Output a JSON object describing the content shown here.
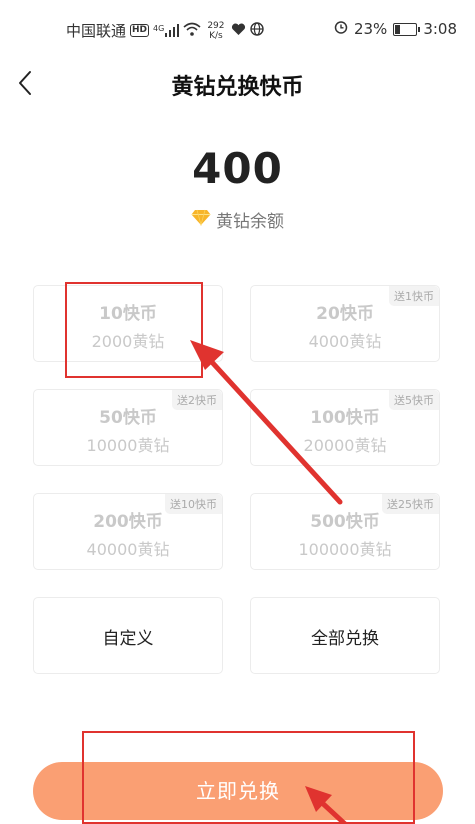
{
  "status_bar": {
    "carrier": "中国联通",
    "network_badge": "HD",
    "network_type": "4G",
    "speed_value": "292",
    "speed_unit": "K/s",
    "battery": "23%",
    "time": "3:08",
    "battery_level": 0.23
  },
  "header": {
    "title": "黄钻兑换快币",
    "back_icon": "chevron-left-icon"
  },
  "balance": {
    "value": "400",
    "label": "黄钻余额",
    "icon": "diamond-icon",
    "icon_color": "#f7b529"
  },
  "options": [
    {
      "coins": "10快币",
      "cost": "2000黄钻",
      "bonus": ""
    },
    {
      "coins": "20快币",
      "cost": "4000黄钻",
      "bonus": "送1快币"
    },
    {
      "coins": "50快币",
      "cost": "10000黄钻",
      "bonus": "送2快币"
    },
    {
      "coins": "100快币",
      "cost": "20000黄钻",
      "bonus": "送5快币"
    },
    {
      "coins": "200快币",
      "cost": "40000黄钻",
      "bonus": "送10快币"
    },
    {
      "coins": "500快币",
      "cost": "100000黄钻",
      "bonus": "送25快币"
    }
  ],
  "custom_option": "自定义",
  "all_option": "全部兑换",
  "redeem_button": "立即兑换",
  "colors": {
    "accent": "#fa9f73",
    "annotation": "#e0332f"
  }
}
